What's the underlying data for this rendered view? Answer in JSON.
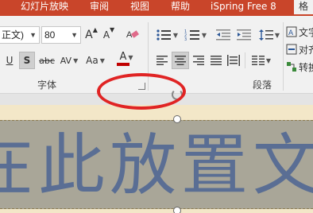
{
  "tabs": [
    {
      "label": "幻灯片放映"
    },
    {
      "label": "审阅"
    },
    {
      "label": "视图"
    },
    {
      "label": "帮助"
    },
    {
      "label": "iSpring Free 8"
    },
    {
      "label": "格"
    }
  ],
  "font_group": {
    "font_name": "正文)",
    "font_size": "80",
    "label": "字体",
    "buttons": {
      "grow": "A",
      "shrink": "A",
      "underline": "U",
      "shadow": "S",
      "strikethrough": "abc",
      "spacing": "AV",
      "case": "Aa",
      "color": "A"
    }
  },
  "paragraph_group": {
    "label": "段落",
    "right_items": [
      "文字",
      "对齐",
      "转换"
    ]
  },
  "slide": {
    "text": "在此放置文"
  },
  "colors": {
    "accent": "#c9452a",
    "font_color_bar": "#c00000",
    "annotation": "#e02424"
  }
}
